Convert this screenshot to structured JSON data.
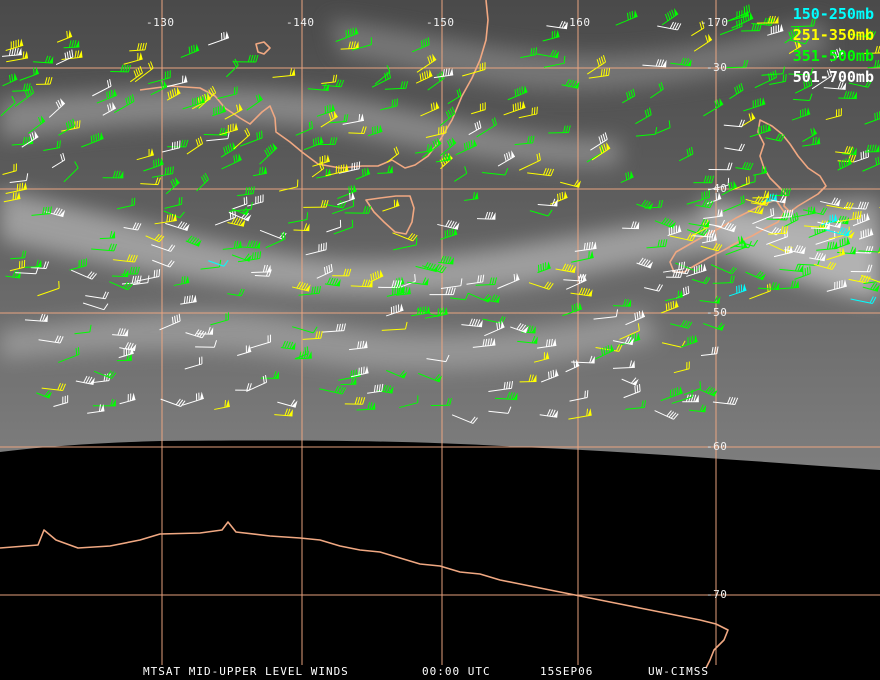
{
  "colors": {
    "grid": "#f0a882",
    "coast": "#f0a882",
    "barb_150_250": "#00ffff",
    "barb_251_350": "#ffff00",
    "barb_351_500": "#00ff00",
    "barb_501_700": "#ffffff",
    "imagery_dark": "#3a3a3a",
    "imagery_light": "#b8b8b8",
    "space": "#000000"
  },
  "map": {
    "projection": "geographic grid, longitudes west of dateline labelled",
    "longitude_labels": [
      "-130",
      "-140",
      "-150",
      "-160",
      "-170"
    ],
    "latitude_labels": [
      "-30",
      "-40",
      "-50",
      "-60",
      "-70"
    ]
  },
  "legend": [
    {
      "label": "150-250mb",
      "color": "#00ffff"
    },
    {
      "label": "251-350mb",
      "color": "#ffff00"
    },
    {
      "label": "351-500mb",
      "color": "#00ff00"
    },
    {
      "label": "501-700mb",
      "color": "#ffffff"
    }
  ],
  "footer": {
    "product": "MTSAT MID-UPPER LEVEL WINDS",
    "time": "00:00 UTC",
    "date": "15SEP06",
    "source": "UW-CIMSS"
  }
}
